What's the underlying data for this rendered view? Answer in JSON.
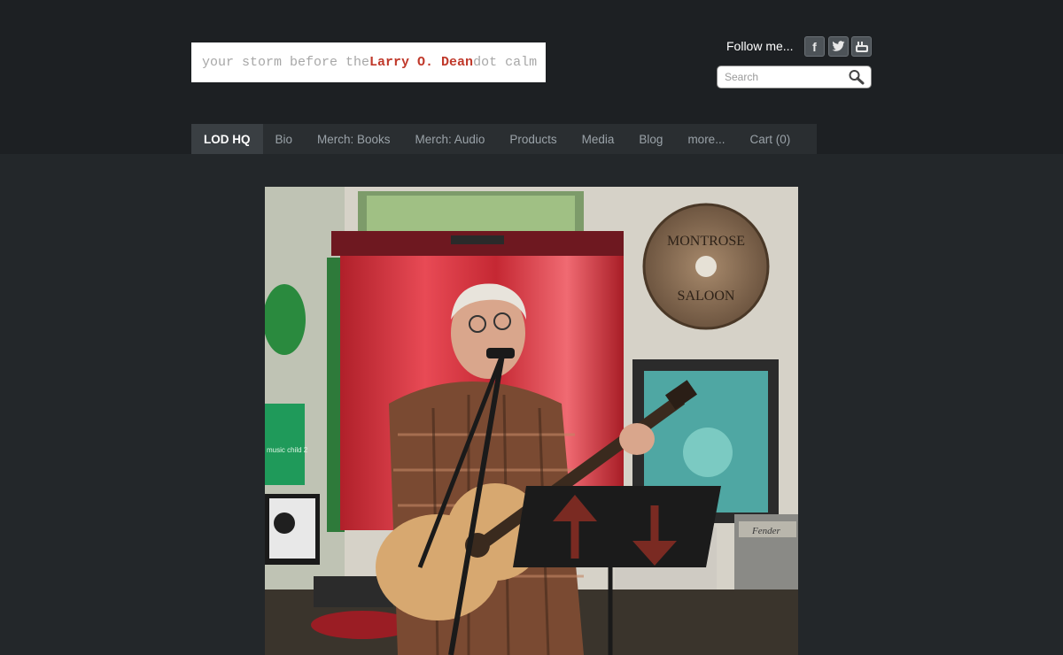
{
  "header": {
    "logo": {
      "part1": "your storm before the ",
      "part2": "Larry O. Dean",
      "part3": " dot calm"
    },
    "follow_label": "Follow me...",
    "social": {
      "facebook_glyph": "f",
      "icons": [
        "facebook-icon",
        "twitter-icon",
        "youtube-icon"
      ]
    },
    "search": {
      "placeholder": "Search"
    }
  },
  "nav": {
    "items": [
      "LOD HQ",
      "Bio",
      "Merch: Books",
      "Merch: Audio",
      "Products",
      "Media",
      "Blog",
      "more...",
      "Cart (0)"
    ],
    "active": "LOD HQ"
  },
  "photo": {
    "sign_top": "MONTROSE",
    "sign_bottom": "SALOON",
    "amp_label": "Fender",
    "poster_text": "music child 2"
  },
  "colors": {
    "page_bg": "#23272a",
    "header_bg": "#1d2023",
    "nav_active_bg": "#3a3f43",
    "logo_accent": "#c0392b"
  }
}
